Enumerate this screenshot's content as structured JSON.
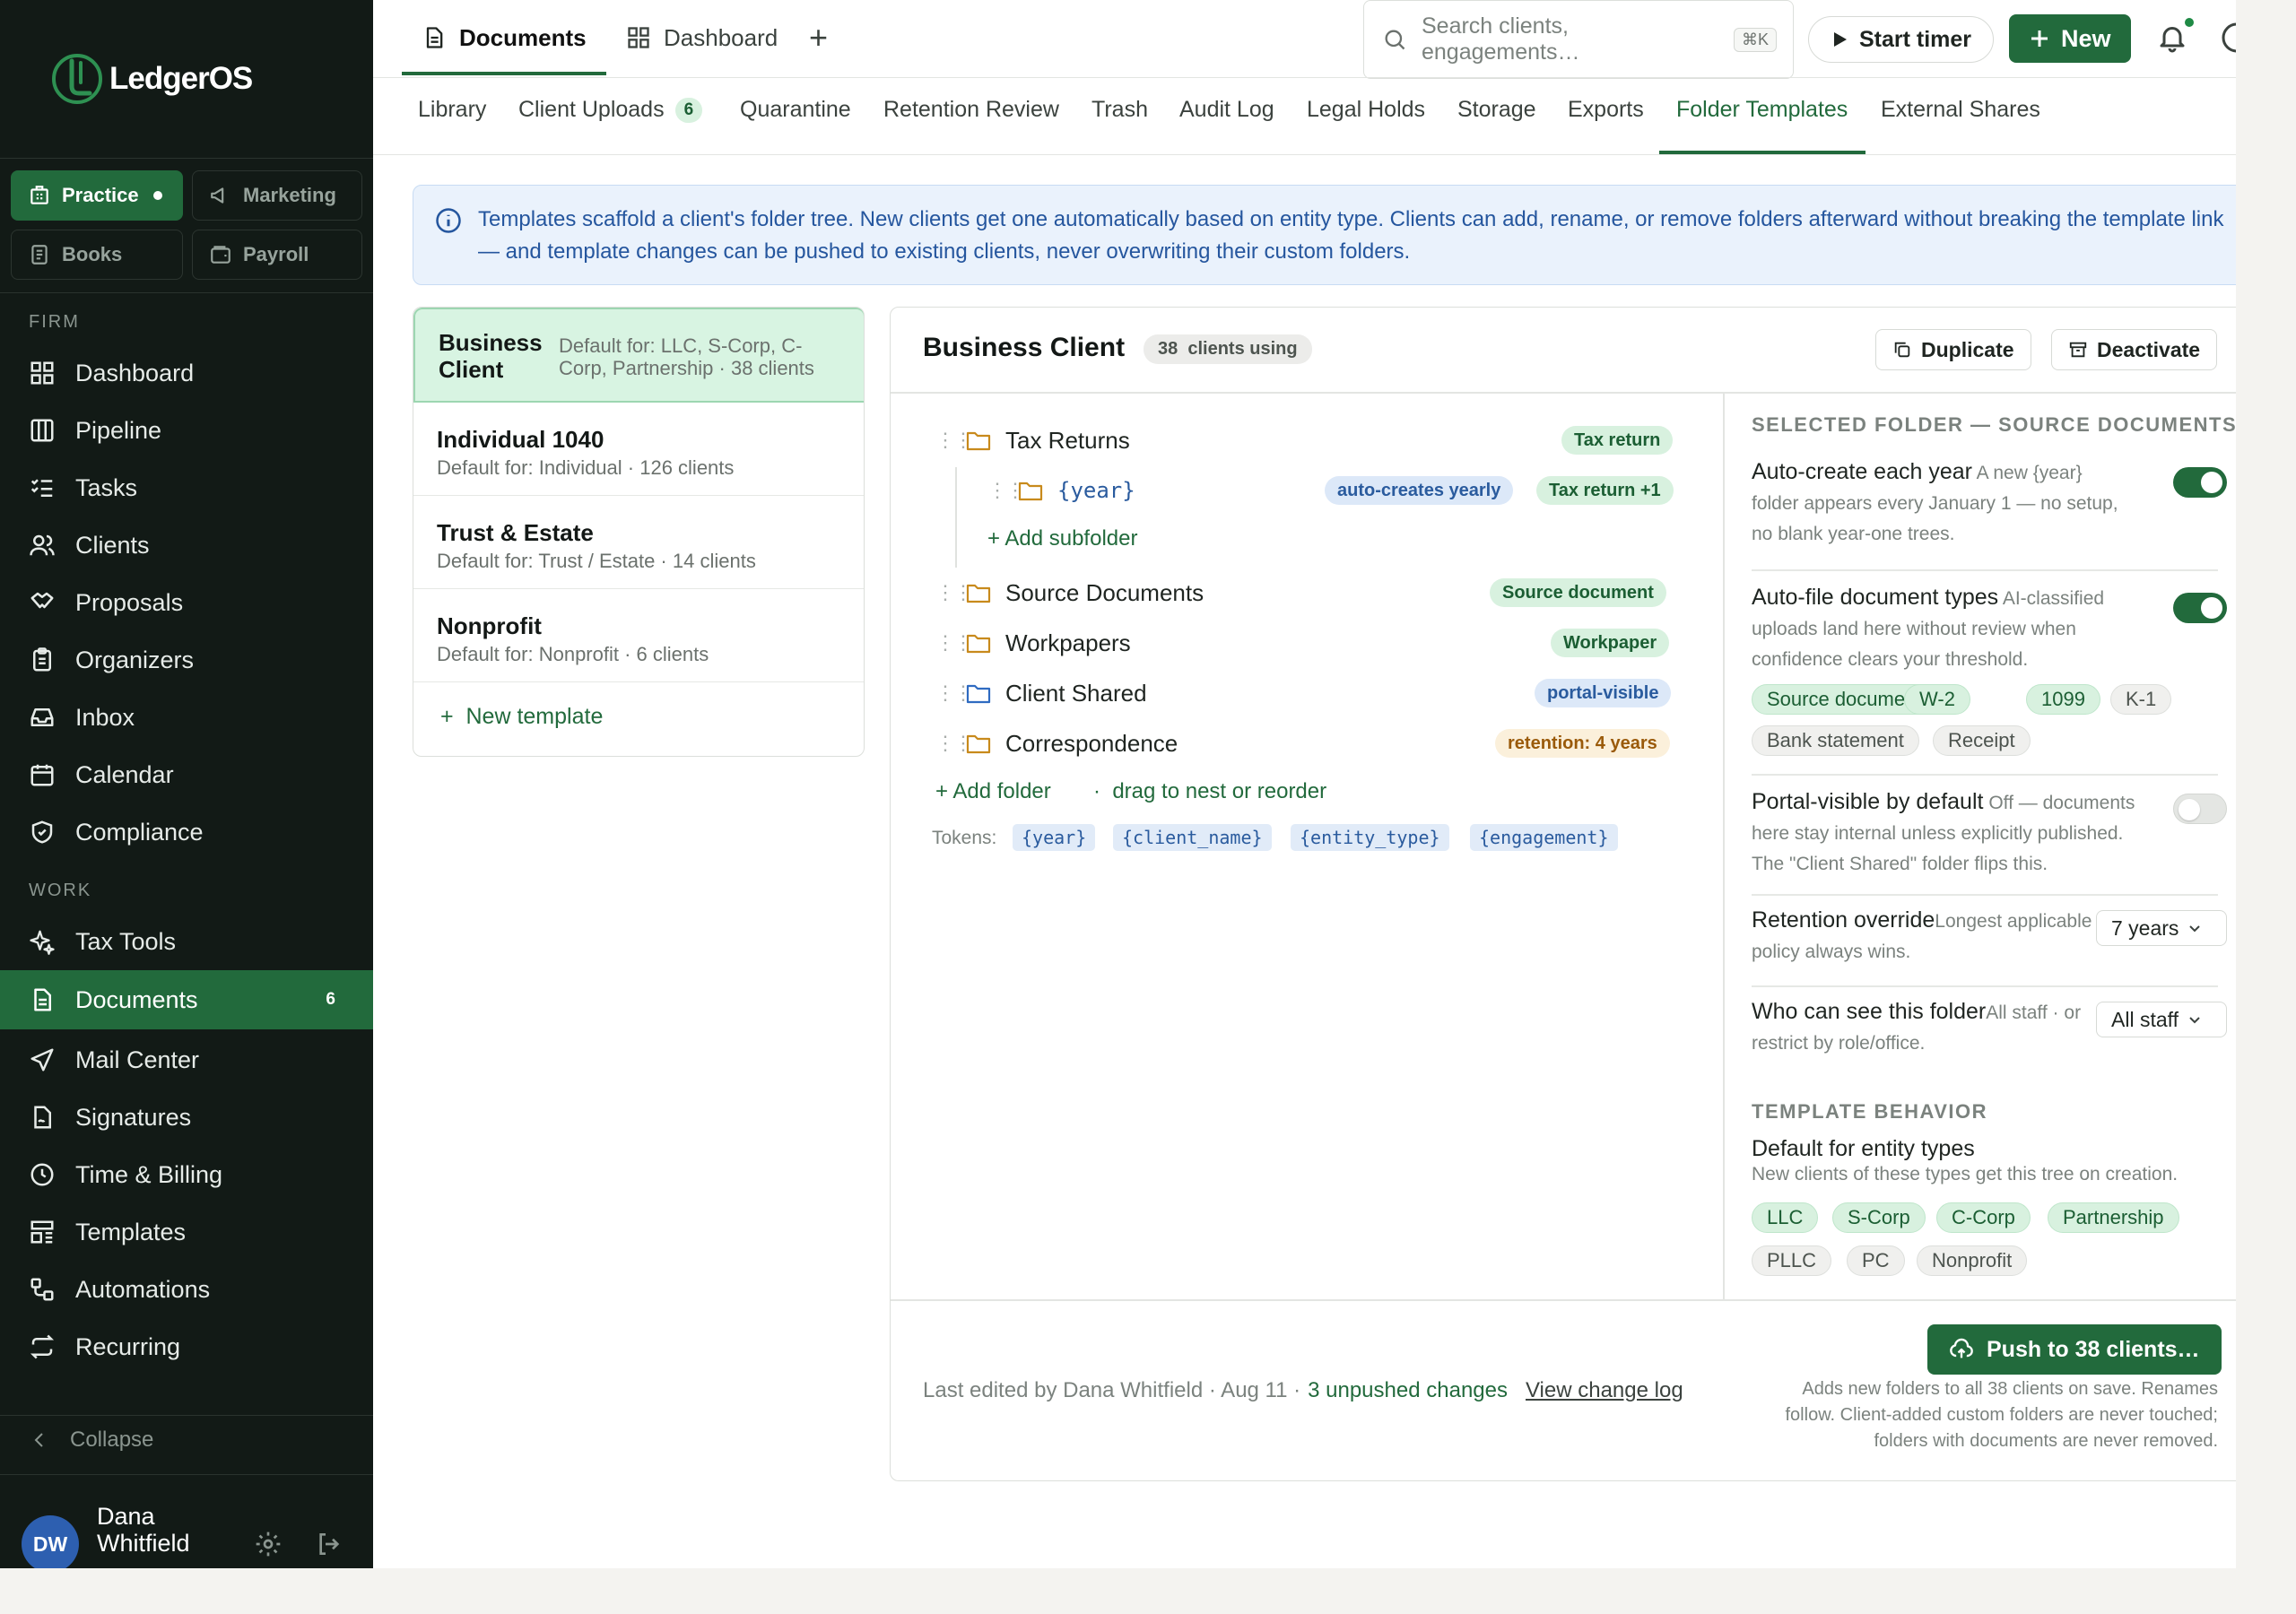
{
  "app": {
    "name": "LedgerOS"
  },
  "colors": {
    "brand": "#226a3c",
    "sidebar_bg": "#121a16",
    "info_blue": "#25569e"
  },
  "sidebar": {
    "workspaces": [
      {
        "label": "Practice",
        "icon": "building-icon",
        "active": true
      },
      {
        "label": "Marketing",
        "icon": "megaphone-icon"
      },
      {
        "label": "Books",
        "icon": "ledger-icon"
      },
      {
        "label": "Payroll",
        "icon": "wallet-icon"
      }
    ],
    "section_firm": "FIRM",
    "firm_items": [
      "Dashboard",
      "Pipeline",
      "Tasks",
      "Clients",
      "Proposals",
      "Organizers",
      "Inbox",
      "Calendar",
      "Compliance"
    ],
    "section_work": "WORK",
    "work_items": [
      "Tax Tools",
      "Documents",
      "Mail Center",
      "Signatures",
      "Time & Billing",
      "Templates",
      "Automations",
      "Recurring"
    ],
    "documents_badge": "6",
    "collapse_label": "Collapse",
    "user": {
      "initials": "DW",
      "name": "Dana Whitfield"
    }
  },
  "topbar": {
    "tabs": [
      {
        "label": "Documents",
        "active": true
      },
      {
        "label": "Dashboard"
      }
    ],
    "add_tab": "+",
    "search_placeholder": "Search clients, engagements…",
    "search_shortcut": "⌘K",
    "start_timer": "Start timer",
    "new_button": "New"
  },
  "subtabs": {
    "items": [
      "Library",
      "Client Uploads",
      "Quarantine",
      "Retention Review",
      "Trash",
      "Audit Log",
      "Legal Holds",
      "Storage",
      "Exports",
      "Folder Templates",
      "External Shares"
    ],
    "client_uploads_count": "6",
    "active": "Folder Templates"
  },
  "banner": {
    "text": "Templates scaffold a client's folder tree. New clients get one automatically based on entity type. Clients can add, rename, or remove folders afterward without breaking the template link — and template changes can be pushed to existing clients, never overwriting their custom folders."
  },
  "templates": {
    "items": [
      {
        "name": "Business Client",
        "desc": "Default for: LLC, S-Corp, C-Corp, Partnership · 38 clients",
        "active": true
      },
      {
        "name": "Individual 1040",
        "desc": "Default for: Individual · 126 clients"
      },
      {
        "name": "Trust & Estate",
        "desc": "Default for: Trust / Estate · 14 clients"
      },
      {
        "name": "Nonprofit",
        "desc": "Default for: Nonprofit · 6 clients"
      }
    ],
    "new_template": "New template"
  },
  "detail": {
    "title": "Business Client",
    "using": "38  clients using",
    "duplicate": "Duplicate",
    "deactivate": "Deactivate",
    "folders": {
      "tax_returns": {
        "name": "Tax Returns",
        "tag": "Tax return"
      },
      "year": {
        "name": "{year}",
        "tag1": "auto-creates yearly",
        "tag2": "Tax return +1"
      },
      "add_subfolder": "Add subfolder",
      "source_documents": {
        "name": "Source Documents",
        "tag": "Source document"
      },
      "workpapers": {
        "name": "Workpapers",
        "tag": "Workpaper"
      },
      "client_shared": {
        "name": "Client Shared",
        "tag": "portal-visible"
      },
      "correspondence": {
        "name": "Correspondence",
        "tag": "retention: 4 years"
      }
    },
    "add_folder": "Add folder",
    "drag_hint": "drag to nest or reorder",
    "tokens_label": "Tokens:",
    "tokens": [
      "{year}",
      "{client_name}",
      "{entity_type}",
      "{engagement}"
    ],
    "settings": {
      "heading": "SELECTED FOLDER — SOURCE DOCUMENTS",
      "auto_create": {
        "title": "Auto-create each year",
        "desc": "A new {year} folder appears every January 1 — no setup, no blank year-one trees.",
        "on": true
      },
      "auto_file": {
        "title": "Auto-file document types",
        "desc": "AI-classified uploads land here without review when confidence clears your threshold.",
        "on": true
      },
      "doc_types": [
        {
          "label": "Source document",
          "selected": true
        },
        {
          "label": "W-2",
          "selected": true
        },
        {
          "label": "1099",
          "selected": true
        },
        {
          "label": "K-1",
          "selected": false
        },
        {
          "label": "Bank statement",
          "selected": false
        },
        {
          "label": "Receipt",
          "selected": false
        }
      ],
      "portal_visible": {
        "title": "Portal-visible by default",
        "desc": "Off — documents here stay internal unless explicitly published. The \"Client Shared\" folder flips this.",
        "on": false
      },
      "retention": {
        "title": "Retention override",
        "desc": "Longest applicable policy always wins.",
        "value": "7 years"
      },
      "visibility": {
        "title": "Who can see this folder",
        "desc": "All staff · or restrict by role/office.",
        "value": "All staff"
      },
      "behavior_heading": "TEMPLATE BEHAVIOR",
      "entity_title": "Default for entity types",
      "entity_desc": "New clients of these types get this tree on creation.",
      "entity_types": [
        {
          "label": "LLC",
          "selected": true
        },
        {
          "label": "S-Corp",
          "selected": true
        },
        {
          "label": "C-Corp",
          "selected": true
        },
        {
          "label": "Partnership",
          "selected": true
        },
        {
          "label": "PLLC",
          "selected": false
        },
        {
          "label": "PC",
          "selected": false
        },
        {
          "label": "Nonprofit",
          "selected": false
        }
      ]
    },
    "footer": {
      "last_edited": "Last edited by Dana Whitfield · Aug 11 ·",
      "unpushed": "3 unpushed changes",
      "change_log": "View change log",
      "push_button": "Push to 38 clients…",
      "push_note": "Adds new folders to all 38 clients on save. Renames follow. Client-added custom folders are never touched; folders with documents are never removed."
    }
  }
}
